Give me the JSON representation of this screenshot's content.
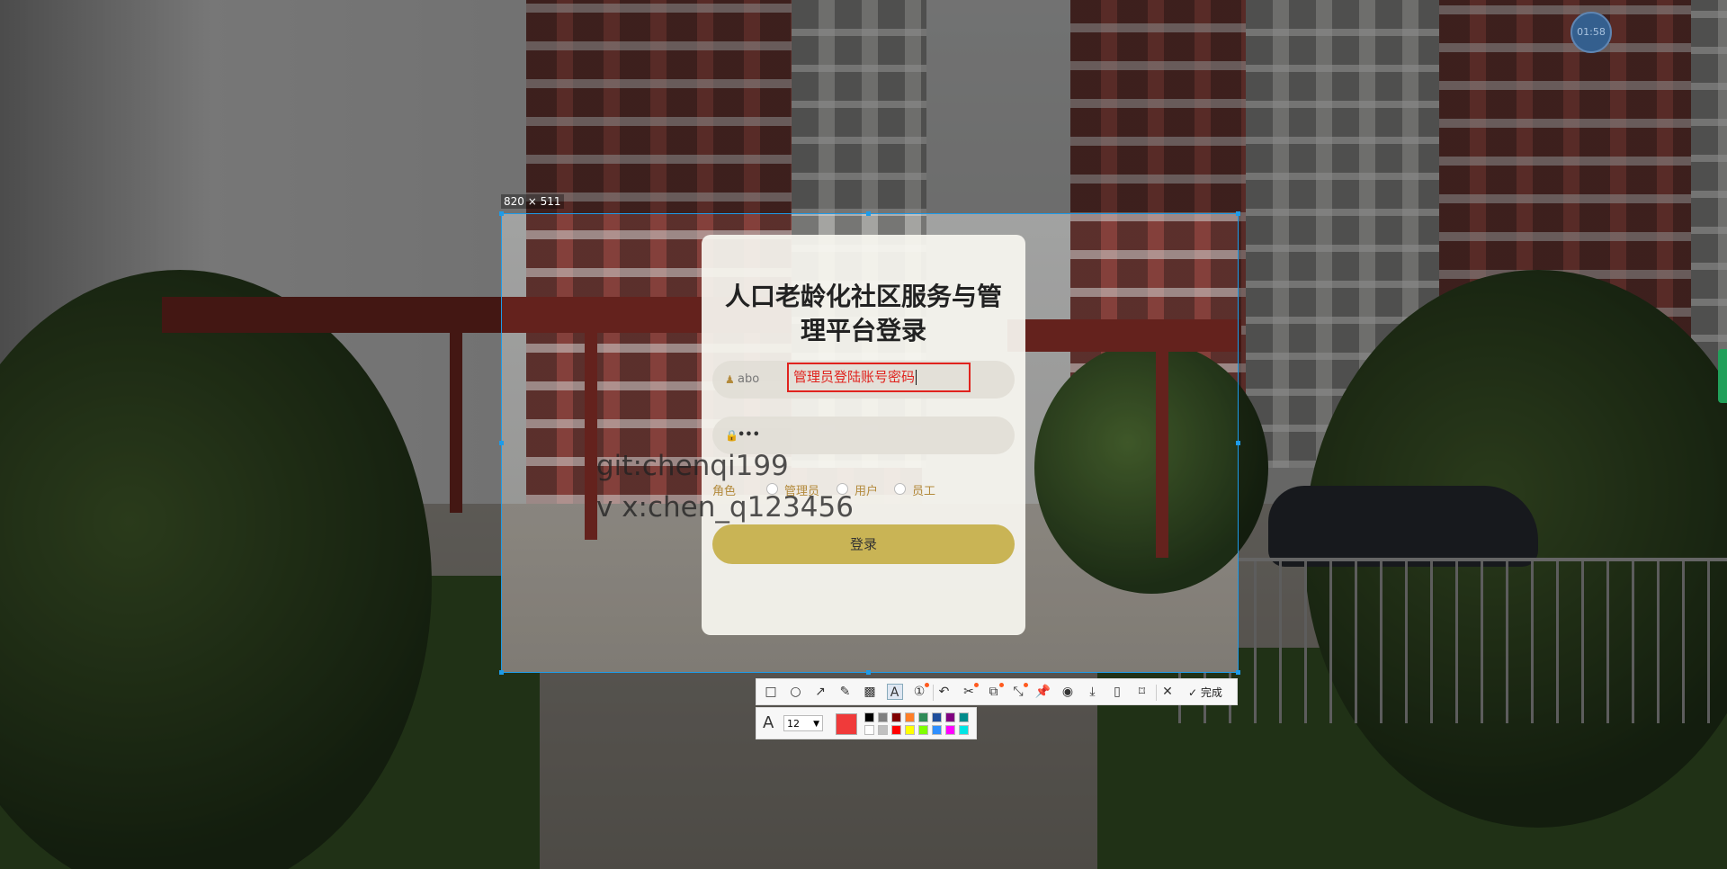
{
  "screenshot_tool": {
    "selection_size_label": "820 × 511",
    "timer_text": "01:58",
    "toolbar": {
      "tools": [
        {
          "name": "rectangle-tool",
          "glyph": "□"
        },
        {
          "name": "ellipse-tool",
          "glyph": "○"
        },
        {
          "name": "arrow-tool",
          "glyph": "↗"
        },
        {
          "name": "pen-tool",
          "glyph": "✎"
        },
        {
          "name": "mosaic-tool",
          "glyph": "▩"
        },
        {
          "name": "text-tool",
          "glyph": "A"
        },
        {
          "name": "number-tool",
          "glyph": "①"
        },
        {
          "name": "undo-tool",
          "glyph": "↶"
        },
        {
          "name": "ocr-tool",
          "glyph": "✂"
        },
        {
          "name": "translate-tool",
          "glyph": "⧉"
        },
        {
          "name": "scroll-capture-tool",
          "glyph": "⤡"
        },
        {
          "name": "pin-tool",
          "glyph": "📌"
        },
        {
          "name": "record-tool",
          "glyph": "◉"
        },
        {
          "name": "download-tool",
          "glyph": "⤓"
        },
        {
          "name": "save-tool",
          "glyph": "▯"
        },
        {
          "name": "bookmark-tool",
          "glyph": "⌑"
        },
        {
          "name": "close-tool",
          "glyph": "✕"
        }
      ],
      "done_label": "完成"
    },
    "text_options": {
      "font_size": "12",
      "current_color": "#f03a3a",
      "swatches_top": [
        "#000000",
        "#808080",
        "#800000",
        "#ff7f27",
        "#2e8b57",
        "#1f4e9c",
        "#800080",
        "#008b8b"
      ],
      "swatches_bottom": [
        "#ffffff",
        "#c0c0c0",
        "#ff0000",
        "#ffff00",
        "#7fff00",
        "#2f8fff",
        "#ff00ff",
        "#00e5e5"
      ]
    }
  },
  "login": {
    "title": "人口老龄化社区服务与管理平台登录",
    "username_value": "abo",
    "password_value": "•••",
    "role_label": "角色",
    "roles": [
      "管理员",
      "用户",
      "员工"
    ],
    "login_button": "登录"
  },
  "annotation_text": "管理员登陆账号密码",
  "watermark": {
    "line1": "git:chenqi199",
    "line2": "v x:chen_q123456"
  },
  "colors": {
    "accent": "#c9b455",
    "selection": "#1e9be8",
    "annotation": "#e0231e"
  }
}
